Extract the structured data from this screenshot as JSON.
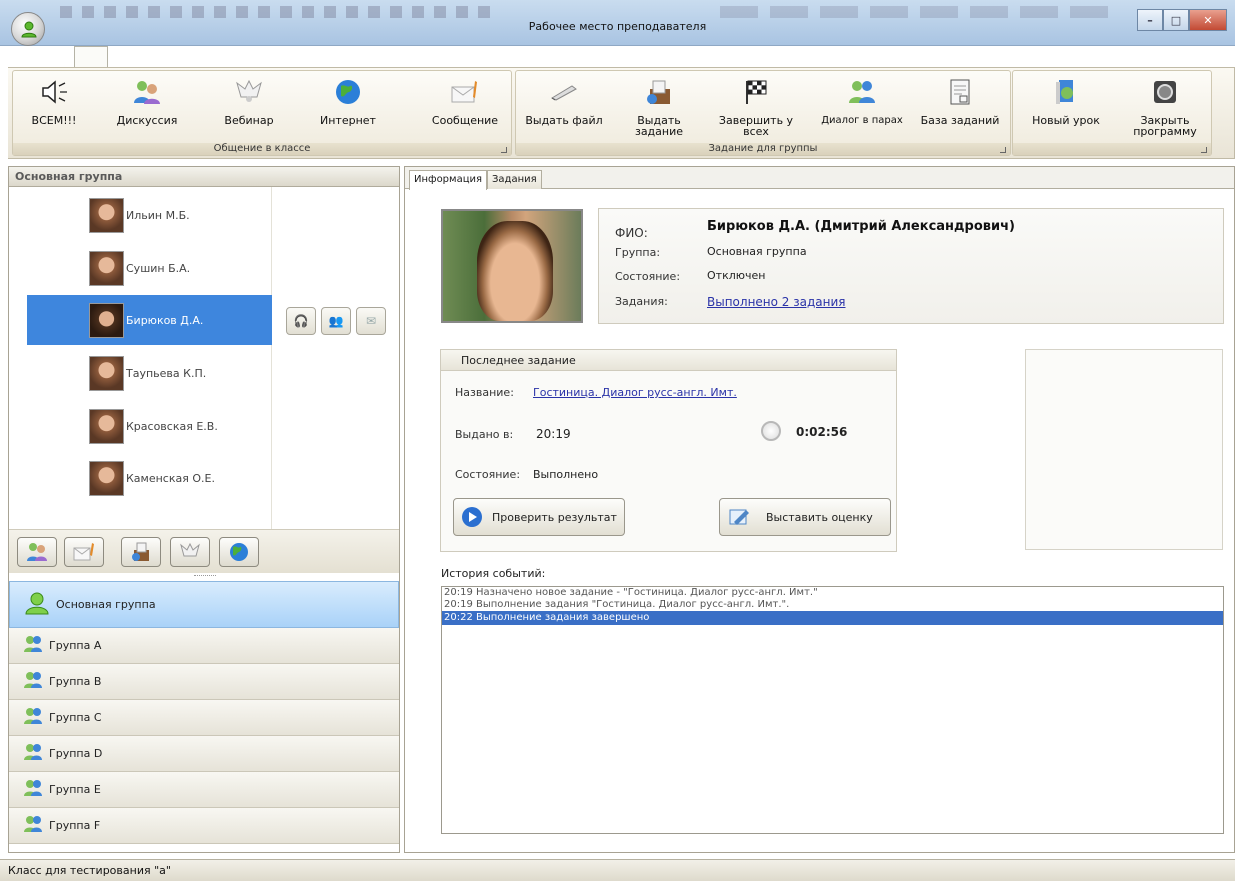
{
  "window": {
    "title": "Рабочее место преподавателя"
  },
  "ribbon": {
    "groups": [
      {
        "label": "Общение в классе",
        "buttons": [
          {
            "label": "ВСЕМ!!!",
            "icon": "speaker-icon"
          },
          {
            "label": "Дискуссия",
            "icon": "discussion-icon"
          },
          {
            "label": "Вебинар",
            "icon": "webinar-icon"
          },
          {
            "label": "Интернет",
            "icon": "globe-icon"
          },
          {
            "label": "Сообщение",
            "icon": "message-icon"
          }
        ]
      },
      {
        "label": "Задание для группы",
        "buttons": [
          {
            "label": "Выдать файл",
            "icon": "pen-icon"
          },
          {
            "label": "Выдать задание",
            "icon": "assign-task-icon"
          },
          {
            "label": "Завершить у всех",
            "icon": "checkered-flag-icon"
          },
          {
            "label": "Диалог в парах",
            "icon": "pair-dialog-icon"
          },
          {
            "label": "База заданий",
            "icon": "task-database-icon"
          }
        ]
      },
      {
        "label": "",
        "buttons": [
          {
            "label": "Новый урок",
            "icon": "new-lesson-icon"
          },
          {
            "label": "Закрыть программу",
            "icon": "close-program-icon"
          }
        ]
      }
    ]
  },
  "left_panel": {
    "header": "Основная группа",
    "students": [
      {
        "name": "Ильин М.Б."
      },
      {
        "name": "Сушин Б.А."
      },
      {
        "name": "Бирюков Д.А.",
        "selected": true
      },
      {
        "name": "Таупьева К.П."
      },
      {
        "name": "Красовская Е.В."
      },
      {
        "name": "Каменская О.Е."
      }
    ],
    "groups": [
      "Основная группа",
      "Группа A",
      "Группа B",
      "Группа C",
      "Группа D",
      "Группа E",
      "Группа F"
    ],
    "selected_group": "Основная группа"
  },
  "tabs": [
    "Информация",
    "Задания"
  ],
  "info": {
    "fio_label": "ФИО:",
    "fio": "Бирюков Д.А. (Дмитрий Александрович)",
    "group_label": "Группа:",
    "group": "Основная группа",
    "state_label": "Состояние:",
    "state": "Отключен",
    "tasks_label": "Задания:",
    "tasks": "Выполнено 2 задания"
  },
  "last_task": {
    "header": "Последнее задание",
    "name_label": "Название:",
    "name": "Гостиница. Диалог русс-англ. Имт.",
    "issued_label": "Выдано в:",
    "issued": "20:19",
    "timer": "0:02:56",
    "state_label": "Состояние:",
    "state": "Выполнено",
    "check_button": "Проверить результат",
    "grade_button": "Выставить оценку"
  },
  "history": {
    "label": "История событий:",
    "rows": [
      "20:19  Назначено новое задание - \"Гостиница. Диалог русс-англ. Имт.\"",
      "20:19 Выполнение задания \"Гостиница. Диалог русс-англ. Имт.\".",
      "20:22 Выполнение задания завершено"
    ],
    "selected_index": 2
  },
  "status": {
    "text": "Класс для тестирования \"а\""
  },
  "colors": {
    "selection": "#3e86dd",
    "history_selection": "#3a6fc6",
    "link": "#2a33a8"
  }
}
